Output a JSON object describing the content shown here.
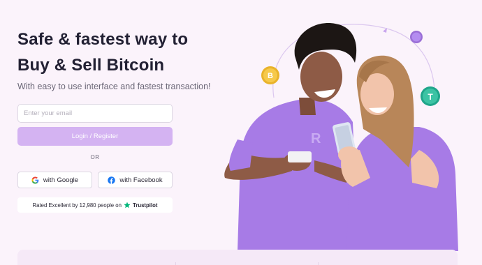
{
  "hero": {
    "headline_line1": "Safe & fastest way to",
    "headline_line2": "Buy & Sell Bitcoin",
    "subtitle": "With easy to use interface and fastest transaction!"
  },
  "signup": {
    "email_placeholder": "Enter your email",
    "email_value": "",
    "login_label": "Login / Register",
    "or_label": "OR",
    "google_label": "with Google",
    "facebook_label": "with Facebook"
  },
  "trust": {
    "text": "Rated Excellent by 12,980 people on",
    "brand": "Trustpilot"
  },
  "colors": {
    "page_background": "#fbf3fb",
    "accent_purple": "#d4b3f2",
    "shirt_purple": "#a77be6",
    "trustpilot_green": "#00b67a",
    "facebook_blue": "#1877f2"
  },
  "icons": {
    "google": "google-icon",
    "facebook": "facebook-icon",
    "trustpilot_star": "trustpilot-star-icon",
    "coins": [
      "bitcoin-coin-icon",
      "tether-coin-icon",
      "tether-coin-icon",
      "purple-coin-icon"
    ]
  }
}
